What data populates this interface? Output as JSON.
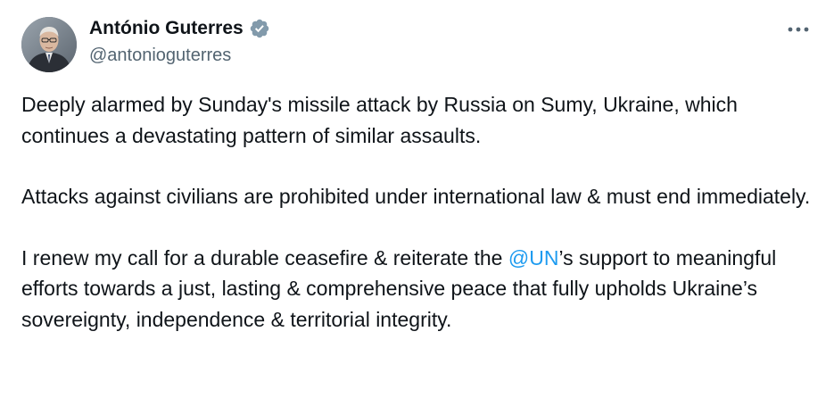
{
  "author": {
    "display_name": "António Guterres",
    "handle": "@antonioguterres",
    "verified": true,
    "verified_color": "#829aab"
  },
  "more_icon": "more-horizontal-icon",
  "tweet": {
    "para1": "Deeply alarmed by Sunday's missile attack by Russia on Sumy, Ukraine, which continues a devastating pattern of similar assaults.",
    "para2": "Attacks against civilians are prohibited under international law & must end immediately.",
    "para3_before": "I renew my call for a durable ceasefire & reiterate the ",
    "para3_mention": "@UN",
    "para3_after": "’s support to meaningful efforts towards a just, lasting & comprehensive peace that fully upholds Ukraine’s sovereignty, independence & territorial integrity."
  },
  "colors": {
    "text": "#0f1419",
    "secondary": "#536471",
    "link": "#1d9bf0"
  }
}
